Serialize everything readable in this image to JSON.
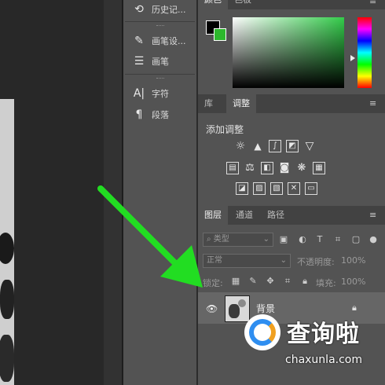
{
  "tool_panel": {
    "items": [
      {
        "label": "历史记...",
        "icon": "history-icon"
      },
      {
        "label": "画笔设...",
        "icon": "brush-settings-icon"
      },
      {
        "label": "画笔",
        "icon": "brush-icon"
      },
      {
        "label": "字符",
        "icon": "character-icon"
      },
      {
        "label": "段落",
        "icon": "paragraph-icon"
      }
    ]
  },
  "color_panel": {
    "tabs": [
      "颜色",
      "色板"
    ],
    "foreground_color": "#000000",
    "background_color": "#2db82d"
  },
  "adjustments_panel": {
    "tabs": [
      "库",
      "调整"
    ],
    "title": "添加调整"
  },
  "layers_panel": {
    "tabs": [
      "图层",
      "通道",
      "路径"
    ],
    "filter_kind": "类型",
    "blend_mode": "正常",
    "opacity_label": "不透明度:",
    "opacity_value": "100%",
    "lock_label": "锁定:",
    "fill_label": "填充:",
    "fill_value": "100%",
    "layers": [
      {
        "name": "背景",
        "visible": true,
        "locked": true
      }
    ]
  },
  "watermark": {
    "title": "查询啦",
    "url": "chaxunla.com"
  },
  "annotation_arrow_color": "#22dd22"
}
